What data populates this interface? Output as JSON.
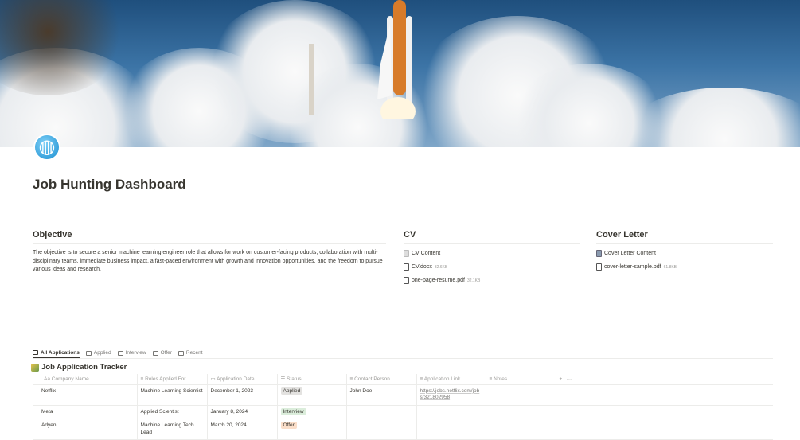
{
  "page": {
    "title": "Job Hunting Dashboard",
    "icon": "globe-icon"
  },
  "objective": {
    "heading": "Objective",
    "text": "The objective is to secure a senior machine learning engineer role that allows for work on customer-facing products, collaboration with multi-disciplinary teams, immediate business impact, a fast-paced environment with growth and innovation opportunities, and the freedom to pursue various ideas and research."
  },
  "cv": {
    "heading": "CV",
    "page_link": "CV Content",
    "files": [
      {
        "name": "CV.docx",
        "size": "32.6KB"
      },
      {
        "name": "one-page-resume.pdf",
        "size": "32.1KB"
      }
    ]
  },
  "cover": {
    "heading": "Cover Letter",
    "page_link": "Cover Letter Content",
    "files": [
      {
        "name": "cover-letter-sample.pdf",
        "size": "61.8KB"
      }
    ]
  },
  "tabs": [
    "All Applications",
    "Applied",
    "Interview",
    "Offer",
    "Recent"
  ],
  "tracker": {
    "title": "Job Application Tracker",
    "columns": [
      "Company Name",
      "Roles Applied For",
      "Application Date",
      "Status",
      "Contact Person",
      "Application Link",
      "Notes"
    ],
    "rows": [
      {
        "company": "Netflix",
        "role": "Machine Learning Scientist",
        "date": "December 1, 2023",
        "status": "Applied",
        "contact": "John Doe",
        "link": "https://jobs.netflix.com/jobs/321802958",
        "notes": ""
      },
      {
        "company": "Meta",
        "role": "Applied Scientist",
        "date": "January 8, 2024",
        "status": "Interview",
        "contact": "",
        "link": "",
        "notes": ""
      },
      {
        "company": "Adyen",
        "role": "Machine Learning Tech Lead",
        "date": "March 20, 2024",
        "status": "Offer",
        "contact": "",
        "link": "",
        "notes": ""
      }
    ]
  },
  "colors": {
    "Applied": "#e3e2e0",
    "Interview": "#dbeddb",
    "Offer": "#fadec9"
  }
}
